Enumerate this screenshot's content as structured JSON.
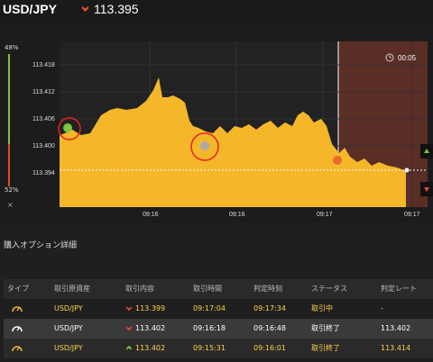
{
  "header": {
    "pair": "USD/JPY",
    "price": "113.395",
    "price_direction": "down",
    "colors": {
      "down": "#e04b2b",
      "up": "#7cc443"
    }
  },
  "chart": {
    "left_percent_top": "48%",
    "left_percent_bottom": "52%",
    "close_symbol": "×",
    "countdown": "00:05",
    "y_labels": [
      "113.418",
      "113.412",
      "113.406",
      "113.400",
      "113.394"
    ],
    "x_labels": [
      "09:16",
      "09:16",
      "09:17",
      "09:17"
    ],
    "area_color": "#f5b72a",
    "expiry_zone_color": "#5a2d25"
  },
  "section": {
    "title": "購入オプション詳細"
  },
  "table": {
    "headers": [
      "タイプ",
      "取引原資産",
      "取引内容",
      "取引時間",
      "判定時刻",
      "ステータス",
      "判定レート"
    ],
    "rows": [
      {
        "type_icon": "timer-icon",
        "asset": "USD/JPY",
        "direction": "down",
        "rate": "113.399",
        "time": "09:17:04",
        "judge": "09:17:34",
        "status": "取引中",
        "judge_rate": "-"
      },
      {
        "type_icon": "timer-icon",
        "asset": "USD/JPY",
        "direction": "down",
        "rate": "113.402",
        "time": "09:16:18",
        "judge": "09:16:48",
        "status": "取引終了",
        "judge_rate": "113.402"
      },
      {
        "type_icon": "timer-icon",
        "asset": "USD/JPY",
        "direction": "up",
        "rate": "113.402",
        "time": "09:15:31",
        "judge": "09:16:01",
        "status": "取引終了",
        "judge_rate": "113.414"
      }
    ]
  }
}
